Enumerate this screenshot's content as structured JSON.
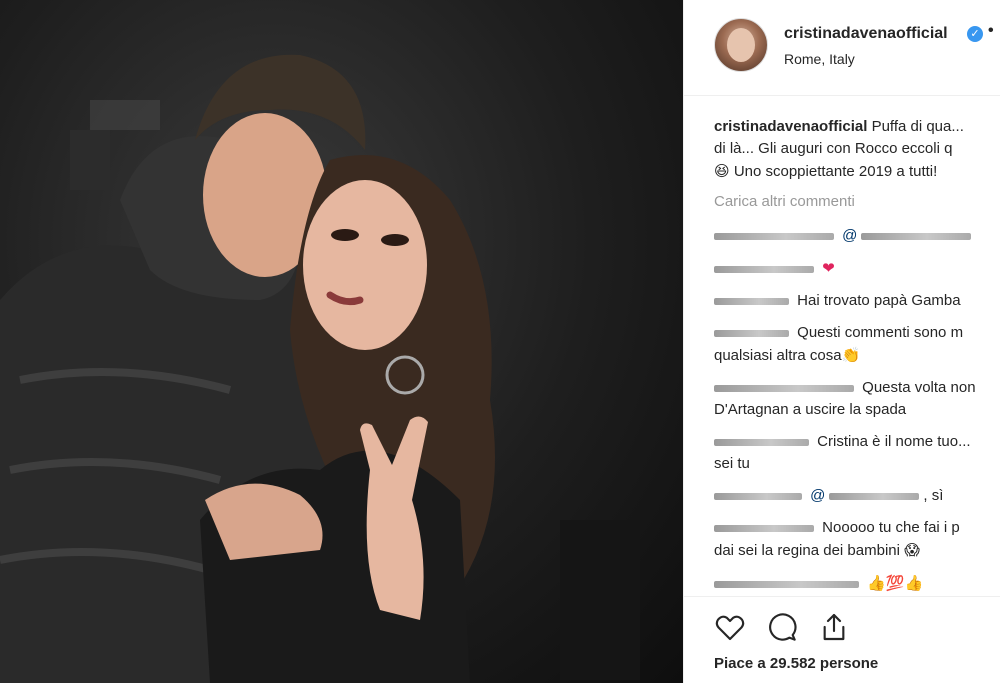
{
  "post": {
    "username": "cristinadavenaofficial",
    "location": "Rome, Italy",
    "verified_symbol": "✓",
    "more_symbol": "•"
  },
  "caption": {
    "username": "cristinadavenaofficial",
    "line1": "Puffa di qua...",
    "line2": "di là... Gli auguri con Rocco eccoli q",
    "line3": "Uno scoppiettante 2019 a tutti!",
    "emoji": "😆"
  },
  "load_more": "Carica altri commenti",
  "comments": [
    {
      "text": "@",
      "mention": true,
      "tail": ""
    },
    {
      "text": "",
      "emoji": "❤"
    },
    {
      "text": "Hai trovato papà Gamba"
    },
    {
      "text": "Questi commenti sono m",
      "line2": "qualsiasi altra cosa",
      "emoji": "👏"
    },
    {
      "text": "Questa volta non",
      "line2": "D'Artagnan a uscire la spada"
    },
    {
      "text": "Cristina è il nome tuo...",
      "line2": "sei tu"
    },
    {
      "text": "@",
      "mention": true,
      "tail": ", sì"
    },
    {
      "text": "Nooooo tu che fai i p",
      "line2": "dai sei la regina dei bambini",
      "emoji": "😱"
    },
    {
      "text": "",
      "emoji": "👍💯👍"
    }
  ],
  "actions": {
    "like_icon": "heart-icon",
    "comment_icon": "comment-icon",
    "share_icon": "share-icon"
  },
  "likes": "Piace a 29.582 persone"
}
